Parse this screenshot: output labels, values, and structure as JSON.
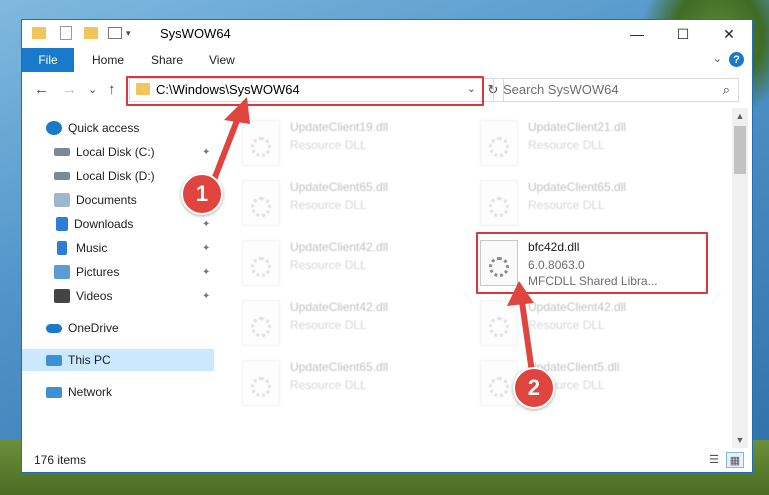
{
  "window": {
    "title": "SysWOW64",
    "minimize_icon": "—",
    "maximize_icon": "☐",
    "close_icon": "✕"
  },
  "ribbon": {
    "tabs": [
      "File",
      "Home",
      "Share",
      "View"
    ],
    "expand_icon": "⌄",
    "help_icon": "?"
  },
  "navigation": {
    "back_icon": "←",
    "forward_icon": "→",
    "recent_icon": "⌄",
    "up_icon": "↑",
    "address": "C:\\Windows\\SysWOW64",
    "address_dropdown_icon": "⌄",
    "refresh_icon": "↻",
    "search_placeholder": "Search SysWOW64",
    "search_icon": "⌕"
  },
  "sidebar": {
    "items": [
      {
        "label": "Quick access",
        "icon": "star-icon",
        "color": "#1979ca",
        "pinned": false
      },
      {
        "label": "Local Disk (C:)",
        "icon": "drive-icon",
        "color": "#7a8a99",
        "pinned": true
      },
      {
        "label": "Local Disk (D:)",
        "icon": "drive-icon",
        "color": "#7a8a99",
        "pinned": true
      },
      {
        "label": "Documents",
        "icon": "documents-icon",
        "color": "#9fb6cf",
        "pinned": true
      },
      {
        "label": "Downloads",
        "icon": "downloads-icon",
        "color": "#2a7fd4",
        "pinned": true
      },
      {
        "label": "Music",
        "icon": "music-icon",
        "color": "#2a7fd4",
        "pinned": true
      },
      {
        "label": "Pictures",
        "icon": "pictures-icon",
        "color": "#5c9bd6",
        "pinned": true
      },
      {
        "label": "Videos",
        "icon": "videos-icon",
        "color": "#444444",
        "pinned": true
      },
      {
        "label": "OneDrive",
        "icon": "cloud-icon",
        "color": "#1979ca",
        "pinned": false
      },
      {
        "label": "This PC",
        "icon": "computer-icon",
        "color": "#3d8fd6",
        "pinned": false
      },
      {
        "label": "Network",
        "icon": "network-icon",
        "color": "#3d8fd6",
        "pinned": false
      }
    ],
    "pin_icon": "📌"
  },
  "files": [
    {
      "name": "UpdateClient19.dll",
      "type": "Resource DLL",
      "faded": true
    },
    {
      "name": "UpdateClient21.dll",
      "type": "Resource DLL",
      "faded": true
    },
    {
      "name": "UpdateClient65.dll",
      "type": "Resource DLL",
      "faded": true
    },
    {
      "name": "UpdateClient65.dll",
      "type": "Resource DLL",
      "faded": true
    },
    {
      "name": "UpdateClient42.dll",
      "type": "Resource DLL",
      "faded": true
    },
    {
      "name": "bfc42d.dll",
      "version": "6.0.8063.0",
      "type": "MFCDLL Shared Libra...",
      "faded": false
    },
    {
      "name": "UpdateClient42.dll",
      "type": "Resource DLL",
      "faded": true
    },
    {
      "name": "UpdateClient42.dll",
      "type": "Resource DLL",
      "faded": true
    },
    {
      "name": "UpdateClient65.dll",
      "type": "Resource DLL",
      "faded": true
    },
    {
      "name": "UpdateClient5.dll",
      "type": "Resource DLL",
      "faded": true
    }
  ],
  "status": {
    "item_count": "176 items",
    "details_view_icon": "☰",
    "tiles_view_icon": "▦"
  },
  "callouts": {
    "step1": "1",
    "step2": "2",
    "color": "#e0443f"
  }
}
